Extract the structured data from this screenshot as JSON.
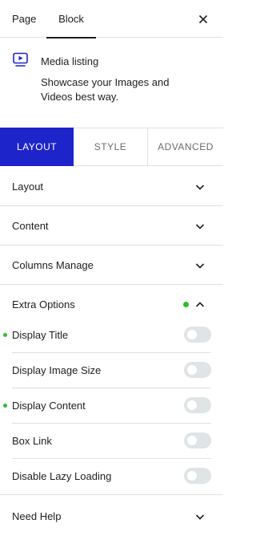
{
  "top_tabs": {
    "page": "Page",
    "block": "Block",
    "close_icon": "close-icon"
  },
  "block_card": {
    "icon": "video-play-icon",
    "title": "Media listing",
    "description": "Showcase your Images and Videos best way."
  },
  "panel_tabs": {
    "layout": "LAYOUT",
    "style": "STYLE",
    "advanced": "ADVANCED",
    "active": "LAYOUT"
  },
  "sections": {
    "layout": "Layout",
    "content": "Content",
    "columns": "Columns Manage",
    "extra": "Extra Options",
    "help": "Need Help"
  },
  "extra_options": [
    {
      "label": "Display Title",
      "on": false,
      "modified": true
    },
    {
      "label": "Display Image Size",
      "on": false,
      "modified": false
    },
    {
      "label": "Display Content",
      "on": false,
      "modified": true
    },
    {
      "label": "Box Link",
      "on": false,
      "modified": false
    },
    {
      "label": "Disable Lazy Loading",
      "on": false,
      "modified": false
    }
  ],
  "colors": {
    "accent": "#1d24c9",
    "modified_dot": "#2fbd2f",
    "toggle_off": "#dfe4e7",
    "border": "#e0e0e0"
  }
}
